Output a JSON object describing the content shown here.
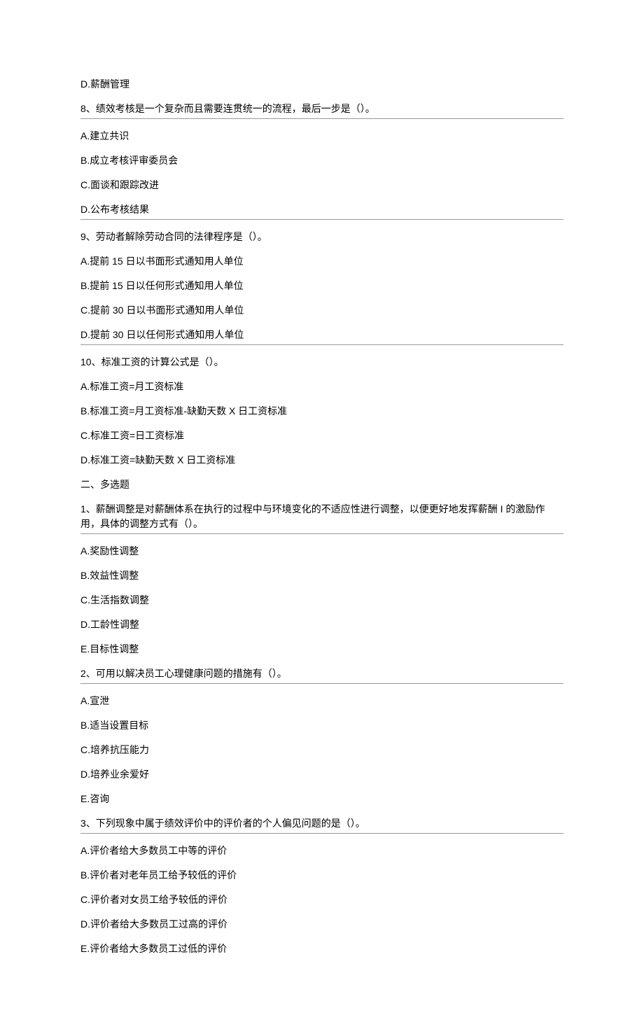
{
  "items": [
    {
      "type": "line",
      "text": "D.薪酬管理"
    },
    {
      "type": "question",
      "text": "8、绩效考核是一个复杂而且需要连贯统一的流程，最后一步是（）。"
    },
    {
      "type": "line",
      "text": "A.建立共识"
    },
    {
      "type": "line",
      "text": "B.成立考核评审委员会"
    },
    {
      "type": "line",
      "text": "C.面谈和跟踪改进"
    },
    {
      "type": "question",
      "text": "D.公布考核结果"
    },
    {
      "type": "line",
      "text": "9、劳动者解除劳动合同的法律程序是（）。"
    },
    {
      "type": "line",
      "text": "A.提前 15 日以书面形式通知用人单位"
    },
    {
      "type": "line",
      "text": "B.提前 15 日以任何形式通知用人单位"
    },
    {
      "type": "line",
      "text": "C.提前 30 日以书面形式通知用人单位"
    },
    {
      "type": "question",
      "text": "D.提前 30 日以任何形式通知用人单位"
    },
    {
      "type": "line",
      "text": "10、标准工资的计算公式是（）。"
    },
    {
      "type": "line",
      "text": "A.标准工资=月工资标准"
    },
    {
      "type": "line",
      "text": "B.标准工资=月工资标准-缺勤天数 X 日工资标准"
    },
    {
      "type": "line",
      "text": "C.标准工资=日工资标准"
    },
    {
      "type": "line",
      "text": "D.标准工资=缺勤天数 X 日工资标准"
    },
    {
      "type": "section-title",
      "text": "二、多选题"
    },
    {
      "type": "question",
      "text": "1、薪酬调整是对薪酬体系在执行的过程中与环境变化的不适应性进行调整，以便更好地发挥薪酬 I 的激励作用，具体的调整方式有（）。"
    },
    {
      "type": "line",
      "text": "A.奖励性调整"
    },
    {
      "type": "line",
      "text": "B.效益性调整"
    },
    {
      "type": "line",
      "text": "C.生活指数调整"
    },
    {
      "type": "line",
      "text": "D.工龄性调整"
    },
    {
      "type": "line",
      "text": "E.目标性调整"
    },
    {
      "type": "question",
      "text": "2、可用以解决员工心理健康问题的措施有（）。"
    },
    {
      "type": "line",
      "text": "A.宣泄"
    },
    {
      "type": "line",
      "text": "B.适当设置目标"
    },
    {
      "type": "line",
      "text": "C.培养抗压能力"
    },
    {
      "type": "line",
      "text": "D.培养业余爱好"
    },
    {
      "type": "line",
      "text": "E.咨询"
    },
    {
      "type": "question",
      "text": "3、下列现象中属于绩效评价中的评价者的个人偏见问题的是（）。"
    },
    {
      "type": "line",
      "text": "A.评价者给大多数员工中等的评价"
    },
    {
      "type": "line",
      "text": "B.评价者对老年员工给予较低的评价"
    },
    {
      "type": "line",
      "text": "C.评价者对女员工给予较低的评价"
    },
    {
      "type": "line",
      "text": "D.评价者给大多数员工过高的评价"
    },
    {
      "type": "line",
      "text": "E.评价者给大多数员工过低的评价"
    }
  ]
}
